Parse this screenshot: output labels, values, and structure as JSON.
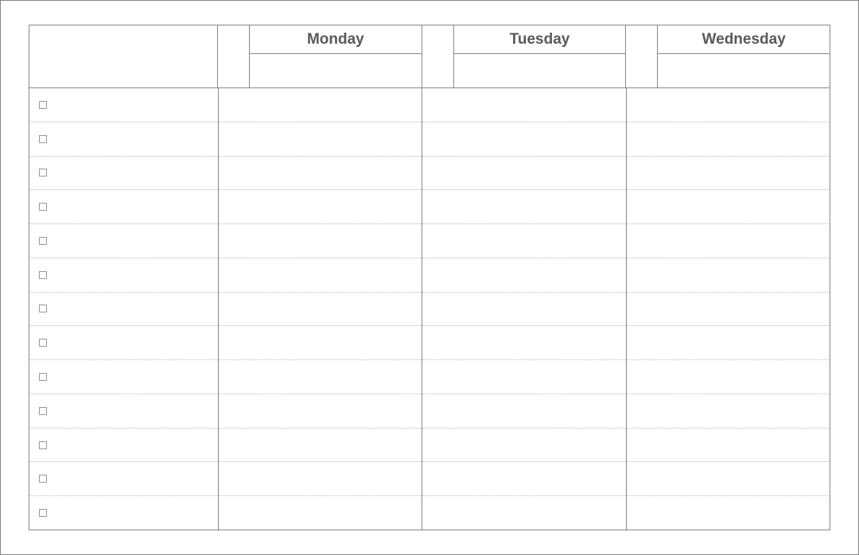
{
  "header": {
    "days": [
      {
        "label": "Monday",
        "sub": ""
      },
      {
        "label": "Tuesday",
        "sub": ""
      },
      {
        "label": "Wednesday",
        "sub": ""
      }
    ]
  },
  "rows": {
    "count": 13,
    "tasks": [
      "",
      "",
      "",
      "",
      "",
      "",
      "",
      "",
      "",
      "",
      "",
      "",
      ""
    ]
  }
}
